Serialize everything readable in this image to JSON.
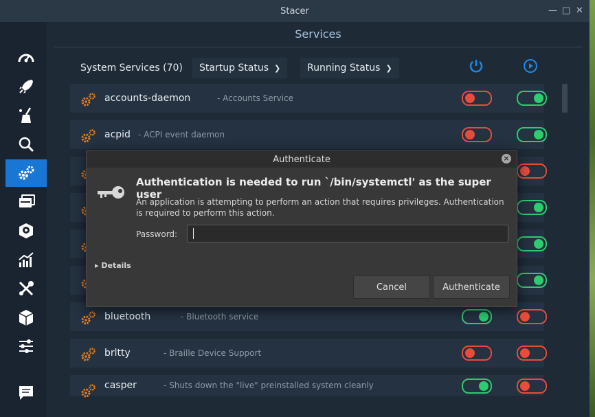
{
  "window": {
    "title": "Stacer"
  },
  "page": {
    "title": "Services"
  },
  "header": {
    "system_services": "System Services (70)",
    "startup_status": "Startup Status",
    "running_status": "Running Status"
  },
  "services": [
    {
      "name": "accounts-daemon",
      "desc": "- Accounts Service",
      "startup": "off",
      "running": "on"
    },
    {
      "name": "acpid",
      "desc": "- ACPI event daemon",
      "startup": "off",
      "running": "on"
    },
    {
      "name": "",
      "desc": "",
      "startup": "",
      "running": "off"
    },
    {
      "name": "",
      "desc": "",
      "startup": "",
      "running": "on"
    },
    {
      "name": "",
      "desc": "",
      "startup": "",
      "running": "on"
    },
    {
      "name": "",
      "desc": "",
      "startup": "",
      "running": "on"
    },
    {
      "name": "bluetooth",
      "desc": "- Bluetooth service",
      "startup": "on",
      "running": "off"
    },
    {
      "name": "brltty",
      "desc": "- Braille Device Support",
      "startup": "off",
      "running": "off"
    },
    {
      "name": "casper",
      "desc": "- Shuts down the \"live\" preinstalled system cleanly",
      "startup": "on",
      "running": "off"
    }
  ],
  "dialog": {
    "title": "Authenticate",
    "heading": "Authentication is needed to run `/bin/systemctl' as the super user",
    "message": "An application is attempting to perform an action that requires privileges. Authentication is required to perform this action.",
    "password_label": "Password:",
    "password_value": "",
    "details": "Details",
    "cancel": "Cancel",
    "authenticate": "Authenticate"
  },
  "colors": {
    "accent": "#1976d2",
    "toggle_on": "#2ecc71",
    "toggle_off": "#e74c3c"
  }
}
